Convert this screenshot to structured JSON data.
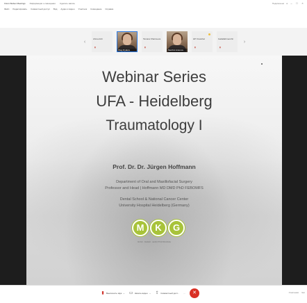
{
  "browser": {
    "tabs": [
      "Cisco Webex Meetings",
      "Информация о совещании",
      "Сделать запись"
    ],
    "menu": [
      "Файл",
      "Редактировать",
      "Совместный доступ",
      "Вид",
      "Аудио и видео",
      "Участник",
      "Совещание",
      "Справка"
    ],
    "right_info": "Подключено",
    "lock_label": "●",
    "minimize": "–",
    "maximize": "□",
    "close": "×"
  },
  "participants": [
    {
      "type": "tile",
      "name": "Ahmed Ali",
      "mic": "mic-muted"
    },
    {
      "type": "video",
      "name": "Oleg Dyakov"
    },
    {
      "type": "tile",
      "name": "Tamara Kharzeeva",
      "mic": "mic-muted"
    },
    {
      "type": "video",
      "name": "Mechini Antonov"
    },
    {
      "type": "tile",
      "name": "HP Kresshat",
      "mic": "mic-muted"
    },
    {
      "type": "tile",
      "name": "Gaballahmed Ali",
      "mic": "mic-muted"
    }
  ],
  "slide": {
    "title_line1": "Webinar Series",
    "title_line2": "UFA - Heidelberg",
    "title_line3": "Traumatology I",
    "speaker": "Prof. Dr. Dr. Jürgen Hoffmann",
    "dept_line1": "Department of Oral and Maxillofacial Surgery",
    "dept_line2": "Professor and Head | Hoffmann MD DMD PhD FEBOMFS",
    "dept_line3": "Dental School & National Cancer Center",
    "dept_line4": "University Hospital Heidelberg (Germany)",
    "logo_letters": [
      "M",
      "K",
      "G"
    ],
    "logo_tag": "MUND · KIEFER · GESICHTSCHIRURGIE",
    "accent_color": "#a8c33a"
  },
  "controls": {
    "mute_label": "Выключить звук",
    "video_label": "Начать видео",
    "share_label": "Совместный дост...",
    "more_label": "…",
    "participants_label": "Участники",
    "chat_label": "Чат"
  }
}
